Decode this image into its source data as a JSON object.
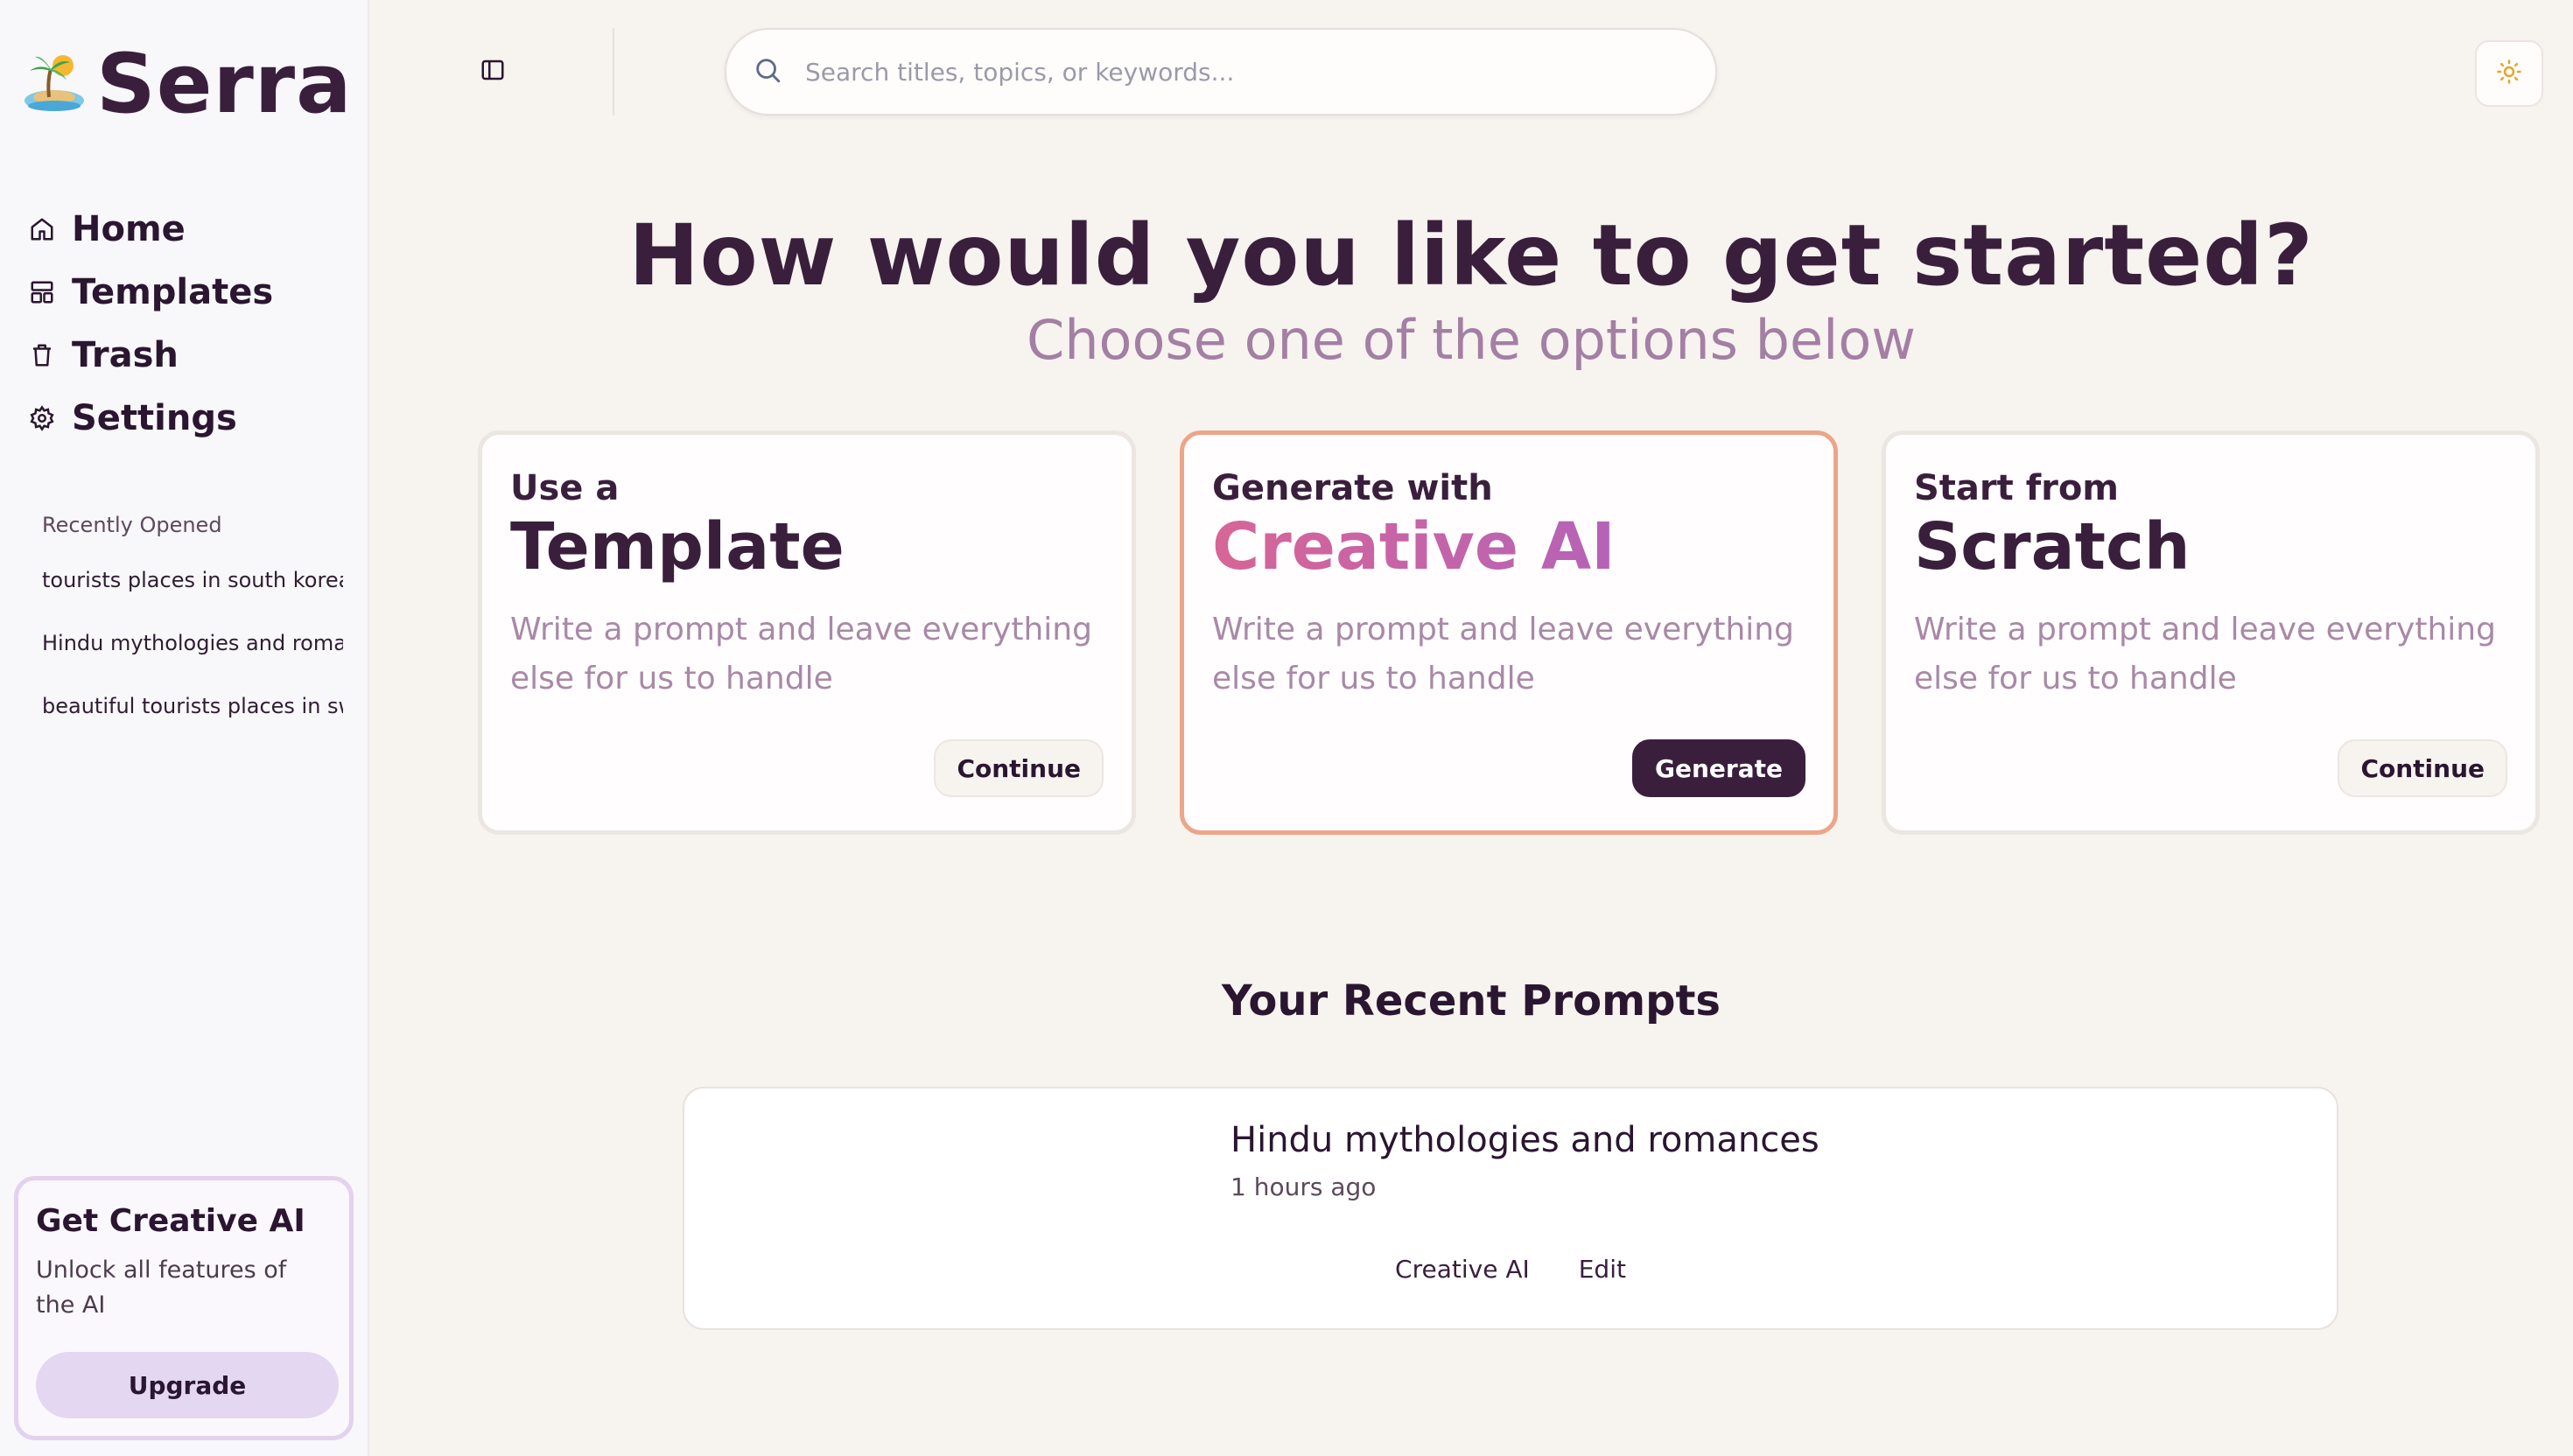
{
  "app": {
    "name": "Serra",
    "logo_icon": "island-logo-icon"
  },
  "sidebar": {
    "nav": [
      {
        "label": "Home",
        "icon": "home-icon"
      },
      {
        "label": "Templates",
        "icon": "templates-icon"
      },
      {
        "label": "Trash",
        "icon": "trash-icon"
      },
      {
        "label": "Settings",
        "icon": "gear-icon"
      }
    ],
    "recent_heading": "Recently Opened",
    "recent": [
      "tourists places in south korea",
      "Hindu mythologies and romances",
      "beautiful tourists places in switzerland"
    ],
    "promo": {
      "title": "Get Creative AI",
      "description": "Unlock all features of the AI",
      "button": "Upgrade"
    }
  },
  "topbar": {
    "sidebar_toggle_icon": "sidebar-toggle-icon",
    "search_placeholder": "Search titles, topics, or keywords...",
    "search_value": "",
    "theme_icon": "sun-icon"
  },
  "hero": {
    "title": "How would you like to get started?",
    "subtitle": "Choose one of the options below"
  },
  "options": [
    {
      "pre": "Use a",
      "main": "Template",
      "description": "Write a prompt and leave everything else for us to handle",
      "button": "Continue"
    },
    {
      "pre": "Generate with",
      "main": "Creative AI",
      "description": "Write a prompt and leave everything else for us to handle",
      "button": "Generate"
    },
    {
      "pre": "Start from",
      "main": "Scratch",
      "description": "Write a prompt and leave everything else for us to handle",
      "button": "Continue"
    }
  ],
  "recent_prompts": {
    "heading": "Your Recent Prompts",
    "items": [
      {
        "title": "Hindu mythologies and romances",
        "time": "1 hours ago",
        "tag": "Creative AI",
        "action": "Edit"
      }
    ]
  },
  "colors": {
    "primary": "#3a1f3d",
    "accent_border": "#eca589",
    "subtitle": "#a47fa4",
    "gradient_start": "#d76597",
    "gradient_end": "#a462c7",
    "promo_button": "#e4d7f1"
  }
}
